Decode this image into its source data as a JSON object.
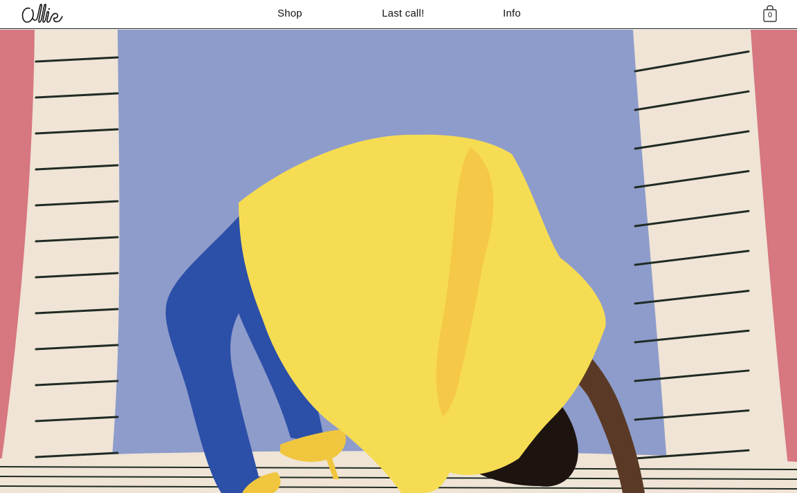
{
  "header": {
    "logo_icon": "callie-script-logo",
    "nav": [
      {
        "label": "Shop"
      },
      {
        "label": "Last call!"
      },
      {
        "label": "Info"
      }
    ],
    "cart": {
      "icon": "shopping-bag-icon",
      "count": "0"
    }
  },
  "hero": {
    "image": "model-in-yellow-dress-and-blue-tights-bending-backwards",
    "colors": {
      "backdrop": "#8e9ccb",
      "stripe_panel": "#efe4d5",
      "stripe": "#1f2b24",
      "side_pink": "#d77780",
      "dress": "#f6dc52",
      "tights": "#2c4fa8",
      "shoe": "#f1c63f",
      "skin": "#5a3a26",
      "hair": "#1d1410"
    }
  }
}
